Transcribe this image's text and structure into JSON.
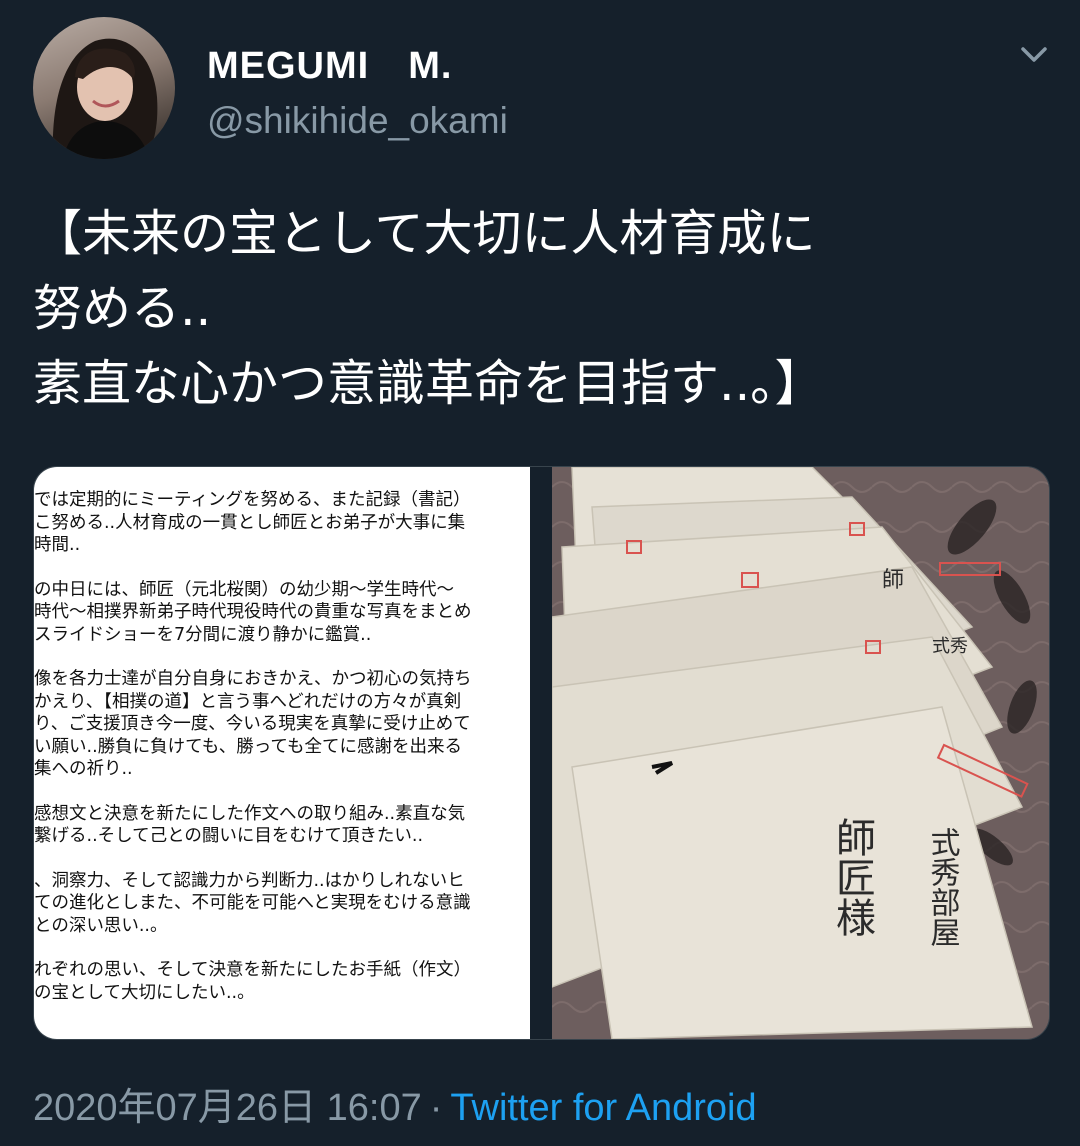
{
  "user": {
    "display_name": "MEGUMI　M.",
    "handle": "@shikihide_okami",
    "menu_icon": "chevron-down-icon"
  },
  "tweet": {
    "lines": [
      "【未来の宝として大切に人材育成に",
      "努める..",
      "素直な心かつ意識革命を目指す..。】"
    ]
  },
  "media": {
    "document_paragraphs": [
      [
        "では定期的にミーティングを努める、また記録（書記）",
        "こ努める..人材育成の一貫とし師匠とお弟子が大事に集",
        "時間.."
      ],
      [
        "の中日には、師匠（元北桜関）の幼少期〜学生時代〜",
        "時代〜相撲界新弟子時代現役時代の貴重な写真をまとめ",
        "スライドショーを7分間に渡り静かに鑑賞.."
      ],
      [
        "像を各力士達が自分自身におきかえ、かつ初心の気持ち",
        "かえり、【相撲の道】と言う事へどれだけの方々が真剣",
        "り、ご支援頂き今一度、今いる現実を真摯に受け止めて",
        "い願い..勝負に負けても、勝っても全てに感謝を出来る",
        "集への祈り.."
      ],
      [
        "感想文と決意を新たにした作文への取り組み..素直な気",
        "繋げる..そして己との闘いに目をむけて頂きたい.."
      ],
      [
        "、洞察力、そして認識力から判断力..はかりしれないヒ",
        "ての進化としまた、不可能を可能へと実現をむける意識",
        "との深い思い..。"
      ],
      [
        "れぞれの思い、そして決意を新たにしたお手紙（作文）",
        "の宝として大切にしたい..。"
      ]
    ],
    "envelope_text": [
      "式秀部屋",
      "師匠様",
      "師",
      "式秀"
    ]
  },
  "meta": {
    "timestamp": "2020年07月26日 16:07",
    "separator": "·",
    "source": "Twitter for Android"
  },
  "colors": {
    "background": "#15202b",
    "secondary_text": "#8899a6",
    "link": "#1da1f2"
  }
}
